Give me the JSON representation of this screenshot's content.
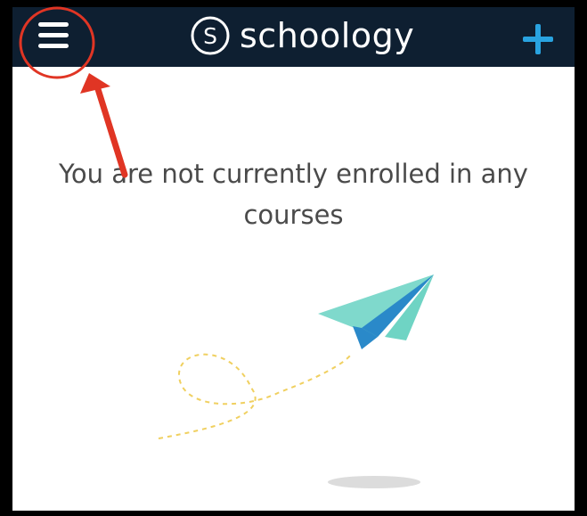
{
  "topbar": {
    "brand": "schoology",
    "logo_letter": "S",
    "background_color": "#0e1f31",
    "menu_icon": "hamburger-menu-icon",
    "add_icon": "plus-icon",
    "accent_color": "#29a3e0"
  },
  "empty_state": {
    "message": "You are not currently enrolled in any courses"
  },
  "annotation": {
    "color": "#e03524"
  }
}
